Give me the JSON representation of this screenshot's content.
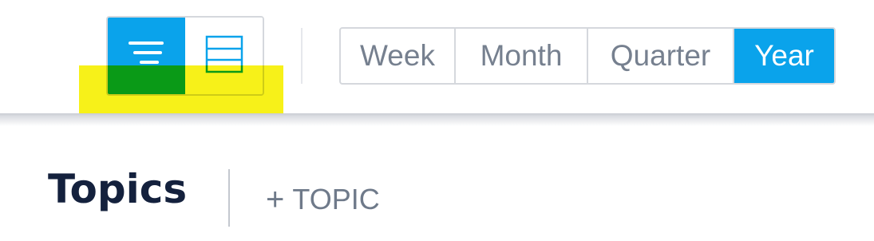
{
  "toolbar": {
    "view_toggle": {
      "options": [
        {
          "id": "list",
          "icon": "list-view-icon",
          "active": true
        },
        {
          "id": "grid",
          "icon": "table-view-icon",
          "active": false
        }
      ]
    },
    "period": {
      "options": [
        "Week",
        "Month",
        "Quarter",
        "Year"
      ],
      "selected": "Year"
    }
  },
  "header": {
    "title": "Topics",
    "add_button": {
      "icon": "+",
      "label": "TOPIC"
    }
  },
  "colors": {
    "accent": "#0aa3eb",
    "title": "#14213d",
    "muted_text": "#76808f",
    "highlight": "#f6f000"
  }
}
